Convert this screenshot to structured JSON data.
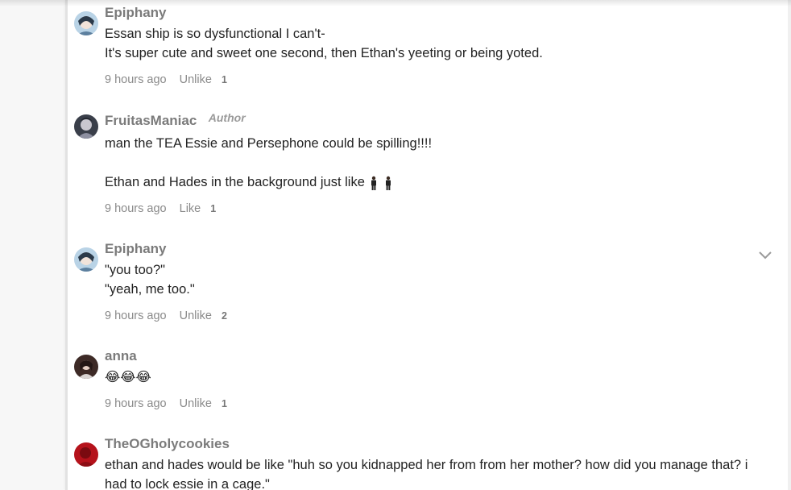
{
  "comments": [
    {
      "username": "Epiphany",
      "author_tag": "",
      "lines": [
        "Essan ship is so dysfunctional I can't-",
        "It's super cute and sweet one second, then Ethan's yeeting or being yoted."
      ],
      "time": "9 hours ago",
      "like_label": "Unlike",
      "like_count": "1",
      "avatar_icon": "anime-character-avatar"
    },
    {
      "username": "FruitasManiac",
      "author_tag": "Author",
      "lines": [
        "man the TEA Essie and Persephone could be spilling!!!!",
        "",
        "Ethan and Hades in the background just like"
      ],
      "emoji_after_last_line": "🕴🕴",
      "time": "9 hours ago",
      "like_label": "Like",
      "like_count": "1",
      "avatar_icon": "dark-hooded-avatar"
    },
    {
      "username": "Epiphany",
      "author_tag": "",
      "lines": [
        "\"you too?\"",
        "\"yeah, me too.\""
      ],
      "time": "9 hours ago",
      "like_label": "Unlike",
      "like_count": "2",
      "avatar_icon": "anime-character-avatar",
      "menu_icon": "chevron-down-icon"
    },
    {
      "username": "anna",
      "author_tag": "",
      "lines": [
        "😂😂😂"
      ],
      "time": "9 hours ago",
      "like_label": "Unlike",
      "like_count": "1",
      "avatar_icon": "portrait-avatar"
    },
    {
      "username": "TheOGholycookies",
      "author_tag": "",
      "lines": [
        "ethan and hades would be like \"huh so you kidnapped her from from her mother? how did you manage that? i",
        "had to lock essie in a cage.\""
      ],
      "time": "",
      "like_label": "",
      "like_count": "",
      "avatar_icon": "red-avatar"
    }
  ],
  "colors": {
    "username": "#7b7b7b",
    "text": "#222222",
    "meta": "#8a8a8a",
    "panel": "#ffffff",
    "background": "#f3f3f3"
  }
}
